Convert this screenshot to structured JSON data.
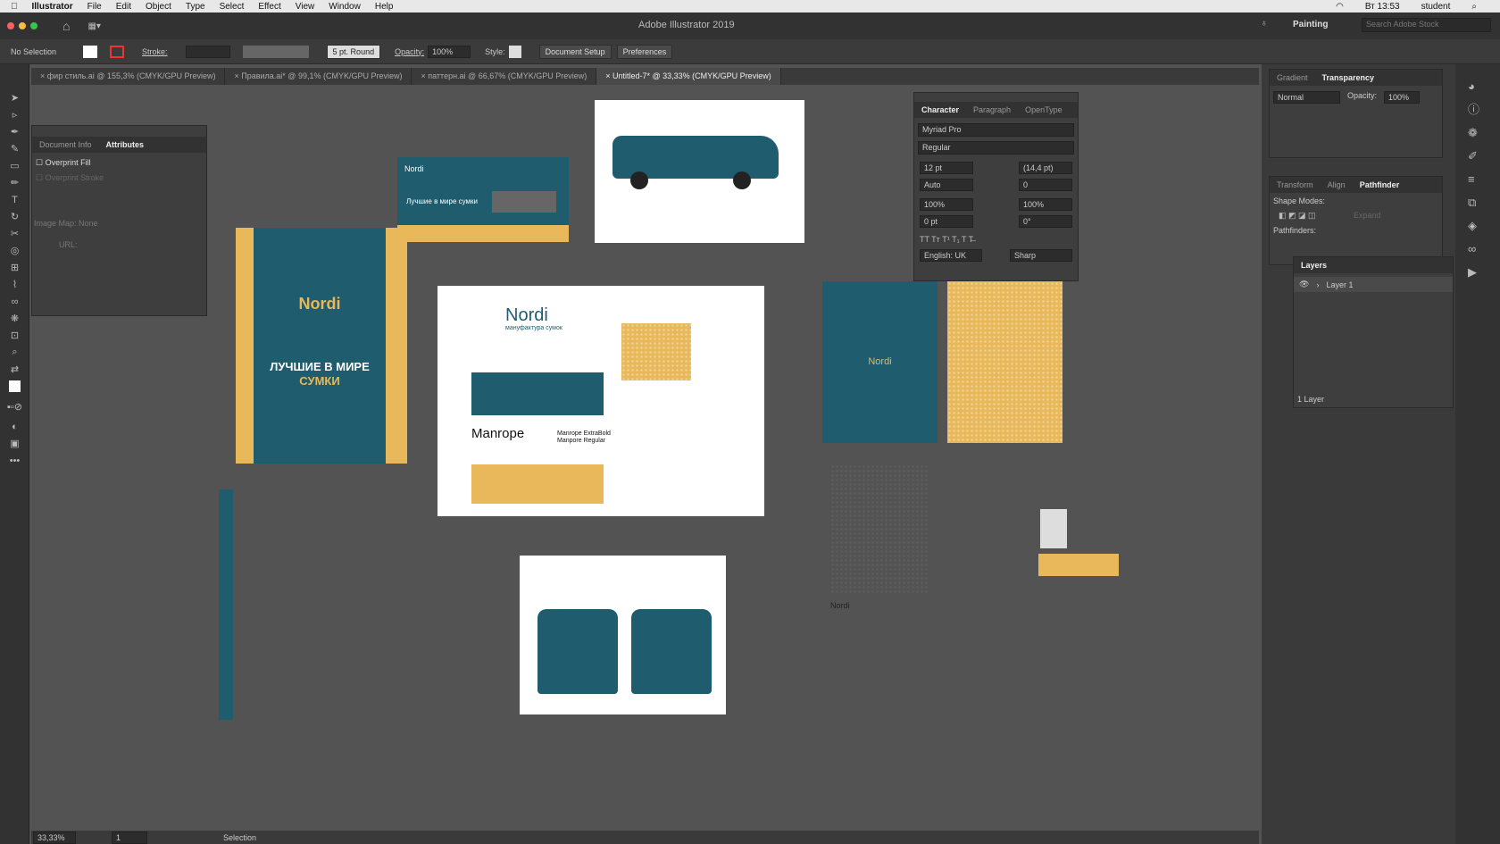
{
  "menubar": {
    "apple": "",
    "app": "Illustrator",
    "items": [
      "File",
      "Edit",
      "Object",
      "Type",
      "Select",
      "Effect",
      "View",
      "Window",
      "Help"
    ],
    "clock": "Вт 13:53",
    "user": "student"
  },
  "title": "Adobe Illustrator 2019",
  "workspace": "Painting",
  "search_placeholder": "Search Adobe Stock",
  "control": {
    "selection": "No Selection",
    "stroke_label": "Stroke:",
    "brush": "5 pt. Round",
    "opacity_label": "Opacity:",
    "opacity": "100%",
    "style_label": "Style:",
    "doc_setup": "Document Setup",
    "preferences": "Preferences"
  },
  "tabs": [
    "фир стиль.ai @ 155,3% (CMYK/GPU Preview)",
    "Правила.ai* @ 99,1% (CMYK/GPU Preview)",
    "паттерн.ai @ 66,67% (CMYK/GPU Preview)",
    "Untitled-7* @ 33,33% (CMYK/GPU Preview)"
  ],
  "attributes": {
    "tab1": "Document Info",
    "tab2": "Attributes",
    "overprint_fill": "Overprint Fill",
    "overprint_stroke": "Overprint Stroke",
    "image_map": "Image Map:",
    "image_map_val": "None",
    "url": "URL:"
  },
  "character": {
    "tab1": "Character",
    "tab2": "Paragraph",
    "tab3": "OpenType",
    "font": "Myriad Pro",
    "style": "Regular",
    "size": "12 pt",
    "leading": "(14,4 pt)",
    "kerning": "Auto",
    "tracking": "0",
    "vscale": "100%",
    "hscale": "100%",
    "baseline": "0 pt",
    "rotation": "0°",
    "lang": "English: UK",
    "aa": "Sharp"
  },
  "transparency": {
    "tab1": "Gradient",
    "tab2": "Transparency",
    "mode": "Normal",
    "opacity_label": "Opacity:",
    "opacity": "100%"
  },
  "pathfinder": {
    "tab1": "Transform",
    "tab2": "Align",
    "tab3": "Pathfinder",
    "shape_modes": "Shape Modes:",
    "pathfinders": "Pathfinders:",
    "expand": "Expand"
  },
  "layers": {
    "tab": "Layers",
    "layer1": "Layer 1",
    "count": "1 Layer"
  },
  "art": {
    "brand": "Nordi",
    "tagline": "мануфактура сумок",
    "slogan": "Лучшие в мире сумки",
    "poster_line1": "ЛУЧШИЕ В МИРЕ",
    "poster_line2": "СУМКИ",
    "font_name": "Manrope",
    "font_w1": "Manrope ExtraBold",
    "font_w2": "Manpore Regular"
  },
  "status": {
    "zoom": "33,33%",
    "page": "1",
    "tool": "Selection"
  },
  "colors": {
    "teal": "#1f5c6e",
    "gold": "#e8b85a"
  }
}
